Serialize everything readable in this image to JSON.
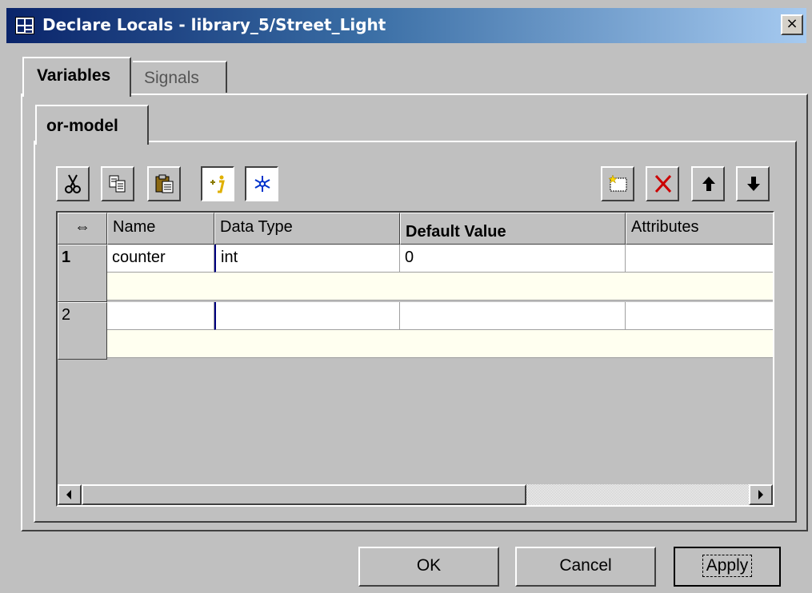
{
  "window": {
    "title": "Declare Locals - library_5/Street_Light",
    "close_symbol": "×",
    "icon": "app-grid-icon"
  },
  "tabs": [
    {
      "label": "Variables",
      "selected": true
    },
    {
      "label": "Signals",
      "selected": false
    }
  ],
  "subtab": {
    "label": "or-model"
  },
  "toolbar": {
    "left": [
      {
        "icon": "cut-icon"
      },
      {
        "icon": "copy-icon"
      },
      {
        "icon": "paste-icon"
      },
      {
        "icon": "insert-info-icon",
        "pressed": true
      },
      {
        "icon": "snowflake-icon",
        "pressed": true
      }
    ],
    "right": [
      {
        "icon": "new-row-icon"
      },
      {
        "icon": "delete-icon"
      },
      {
        "icon": "move-up-icon"
      },
      {
        "icon": "move-down-icon"
      }
    ]
  },
  "table": {
    "corner_symbol": "⇔",
    "columns": [
      "Name",
      "Data Type",
      "Default Value",
      "Attributes"
    ],
    "rows": [
      {
        "number": "1",
        "name": "counter",
        "data_type": "int",
        "default_value": "0",
        "attributes": ""
      },
      {
        "number": "2",
        "name": "",
        "data_type": "",
        "default_value": "",
        "attributes": ""
      }
    ]
  },
  "buttons": {
    "ok": "OK",
    "cancel": "Cancel",
    "apply": "Apply"
  },
  "colors": {
    "title_start": "#0a246a",
    "title_end": "#a6caf0",
    "face": "#c0c0c0",
    "subrow": "#fffff0",
    "delete": "#cc0000"
  }
}
